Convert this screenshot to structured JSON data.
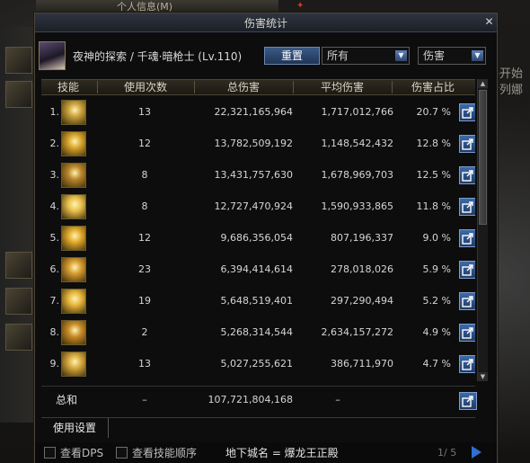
{
  "background_window": {
    "title": "个人信息(M)",
    "right_text_lines": [
      "攻略开始",
      "伊列娜"
    ]
  },
  "window": {
    "title": "伤害统计",
    "close_icon": "close-icon"
  },
  "header": {
    "character": "夜神的探索 / 千魂·暗枪士 (Lv.110)",
    "reset_label": "重置",
    "filter_value": "所有",
    "metric_value": "伤害"
  },
  "columns": [
    "技能",
    "使用次数",
    "总伤害",
    "平均伤害",
    "伤害占比"
  ],
  "rows": [
    {
      "rank": "1.",
      "uses": "13",
      "total": "22,321,165,964",
      "avg": "1,717,012,766",
      "pct": "20.7 %",
      "icon_color": "#c9a13b"
    },
    {
      "rank": "2.",
      "uses": "12",
      "total": "13,782,509,192",
      "avg": "1,148,542,432",
      "pct": "12.8 %",
      "icon_color": "#d8a52c"
    },
    {
      "rank": "3.",
      "uses": "8",
      "total": "13,431,757,630",
      "avg": "1,678,969,703",
      "pct": "12.5 %",
      "icon_color": "#b8862a"
    },
    {
      "rank": "4.",
      "uses": "8",
      "total": "12,727,470,924",
      "avg": "1,590,933,865",
      "pct": "11.8 %",
      "icon_color": "#e8c04a"
    },
    {
      "rank": "5.",
      "uses": "12",
      "total": "9,686,356,054",
      "avg": "807,196,337",
      "pct": "9.0 %",
      "icon_color": "#e0a82a"
    },
    {
      "rank": "6.",
      "uses": "23",
      "total": "6,394,414,614",
      "avg": "278,018,026",
      "pct": "5.9 %",
      "icon_color": "#d49a2e"
    },
    {
      "rank": "7.",
      "uses": "19",
      "total": "5,648,519,401",
      "avg": "297,290,494",
      "pct": "5.2 %",
      "icon_color": "#e6b43a"
    },
    {
      "rank": "8.",
      "uses": "2",
      "total": "5,268,314,544",
      "avg": "2,634,157,272",
      "pct": "4.9 %",
      "icon_color": "#c78a26"
    },
    {
      "rank": "9.",
      "uses": "13",
      "total": "5,027,255,621",
      "avg": "386,711,970",
      "pct": "4.7 %",
      "icon_color": "#d6a83c"
    }
  ],
  "totals": {
    "label": "总和",
    "uses": "–",
    "total": "107,721,804,168",
    "avg": "–"
  },
  "settings_tab": "使用设置",
  "bottom": {
    "dps_label": "查看DPS",
    "order_label": "查看技能顺序",
    "dungeon": "地下城名 = 爆龙王正殿",
    "page": "1/ 5"
  },
  "colors": {
    "accent_blue": "#2e6fd0",
    "skill_gold": "#c9a13b",
    "text": "#d5d5d5"
  }
}
